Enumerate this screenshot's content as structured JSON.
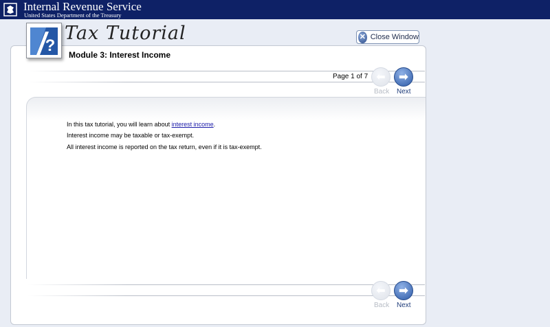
{
  "header": {
    "agency_name": "Internal Revenue Service",
    "department": "United States Department of the Treasury",
    "bg_color": "#0e2166"
  },
  "tutorial": {
    "title": "Tax Tutorial",
    "logo_icon": "question-mark-icon"
  },
  "close_window": {
    "label": "Close Window",
    "icon": "close-x-icon"
  },
  "module": {
    "title": "Module 3: Interest Income"
  },
  "pagination": {
    "page_indicator": "Page 1 of 7",
    "back_label": "Back",
    "next_label": "Next"
  },
  "content": {
    "line1_prefix": "In this tax tutorial, you will learn about ",
    "line1_link": "interest income",
    "line1_suffix": ".",
    "line2": "Interest income may be taxable or tax-exempt.",
    "line3": "All interest income is reported on the tax return, even if it is tax-exempt."
  }
}
